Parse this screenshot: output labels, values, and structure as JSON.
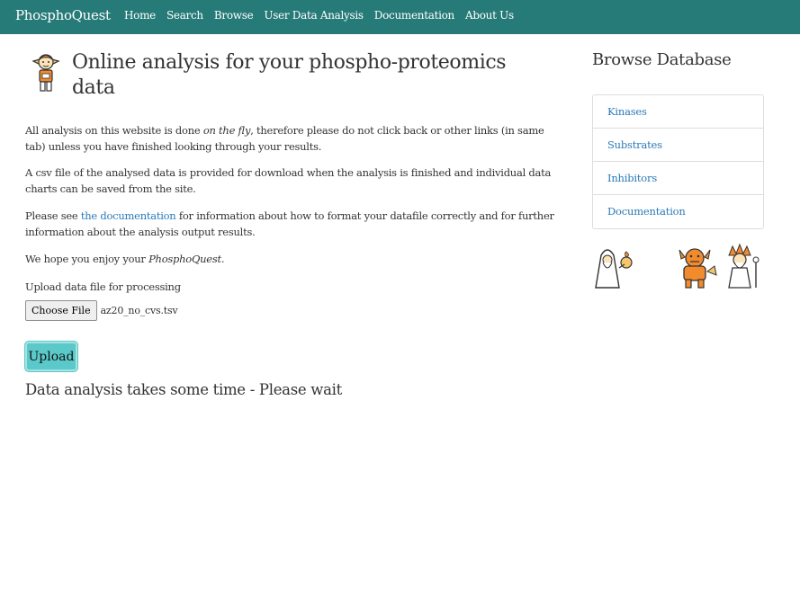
{
  "navbar": {
    "brand": "PhosphoQuest",
    "links": [
      "Home",
      "Search",
      "Browse",
      "User Data Analysis",
      "Documentation",
      "About Us"
    ]
  },
  "main": {
    "title": "Online analysis for your phospho-proteomics data",
    "p1_a": "All analysis on this website is done ",
    "p1_em": "on the fly",
    "p1_b": ", therefore please do not click back or other links (in same tab) unless you have finished looking through your results.",
    "p2": "A csv file of the analysed data is provided for download when the analysis is finished and individual data charts can be saved from the site.",
    "p3_a": "Please see ",
    "p3_link": "the documentation",
    "p3_b": " for information about how to format your datafile correctly and for further information about the analysis output results.",
    "p4_a": "We hope you enjoy your ",
    "p4_em": "PhosphoQuest",
    "p4_b": ".",
    "upload_label": "Upload data file for processing",
    "choose_file": "Choose File",
    "file_name": "az20_no_cvs.tsv",
    "upload_button": "Upload",
    "wait_message": "Data analysis takes some time - Please wait"
  },
  "sidebar": {
    "title": "Browse Database",
    "items": [
      "Kinases",
      "Substrates",
      "Inhibitors",
      "Documentation"
    ]
  },
  "colors": {
    "navbar": "#267a78",
    "link": "#2a7ab8",
    "upload_button": "#5bc9c9",
    "creature_orange": "#f28a2e"
  }
}
